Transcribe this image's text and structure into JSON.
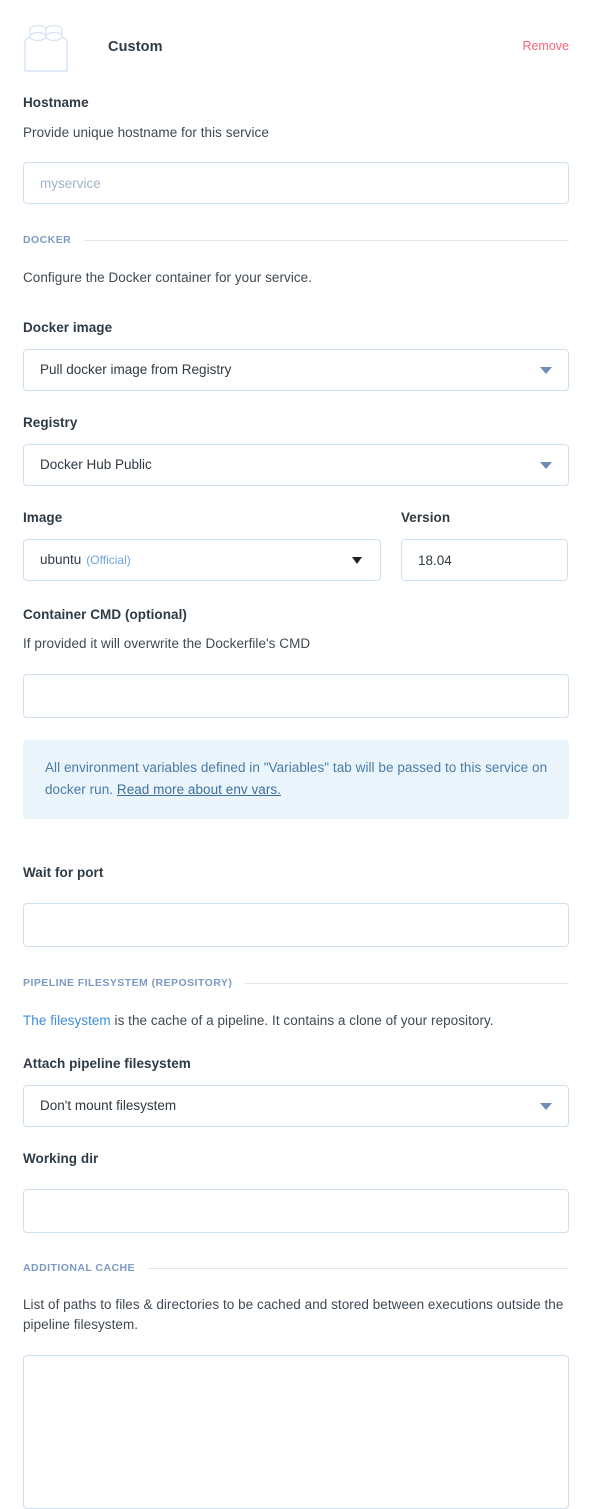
{
  "header": {
    "icon": "lego-brick-icon",
    "title": "Custom",
    "remove_label": "Remove",
    "remove_color": "#f5647a"
  },
  "hostname": {
    "label": "Hostname",
    "help": "Provide unique hostname for this service",
    "placeholder": "myservice",
    "value": ""
  },
  "docker_section": {
    "title": "DOCKER",
    "description": "Configure the Docker container for your service.",
    "docker_image": {
      "label": "Docker image",
      "selected": "Pull docker image from Registry"
    },
    "registry": {
      "label": "Registry",
      "selected": "Docker Hub Public"
    },
    "image": {
      "label": "Image",
      "selected": "ubuntu",
      "badge": "(Official)"
    },
    "version": {
      "label": "Version",
      "value": "18.04"
    },
    "container_cmd": {
      "label": "Container CMD (optional)",
      "help": "If provided it will overwrite the Dockerfile's CMD",
      "value": ""
    },
    "callout": {
      "text": "All environment variables defined in \"Variables\" tab will be passed to this service on docker run. ",
      "link_text": "Read more about env vars."
    },
    "wait_for_port": {
      "label": "Wait for port",
      "value": ""
    }
  },
  "filesystem_section": {
    "title": "PIPELINE FILESYSTEM (REPOSITORY)",
    "desc_link": "The filesystem",
    "desc_rest": " is the cache of a pipeline. It contains a clone of your repository.",
    "attach": {
      "label": "Attach pipeline filesystem",
      "selected": "Don't mount filesystem"
    },
    "working_dir": {
      "label": "Working dir",
      "value": ""
    }
  },
  "cache_section": {
    "title": "ADDITIONAL CACHE",
    "description": "List of paths to files & directories to be cached and stored between executions outside the pipeline filesystem.",
    "value": ""
  },
  "theme": {
    "border": "#cfe0f2",
    "section_label": "#7b9ac4",
    "callout_bg": "#eaf4fb",
    "callout_text": "#4a7ba8",
    "link": "#3d8ddd",
    "arrow": "#6f8cb5"
  }
}
